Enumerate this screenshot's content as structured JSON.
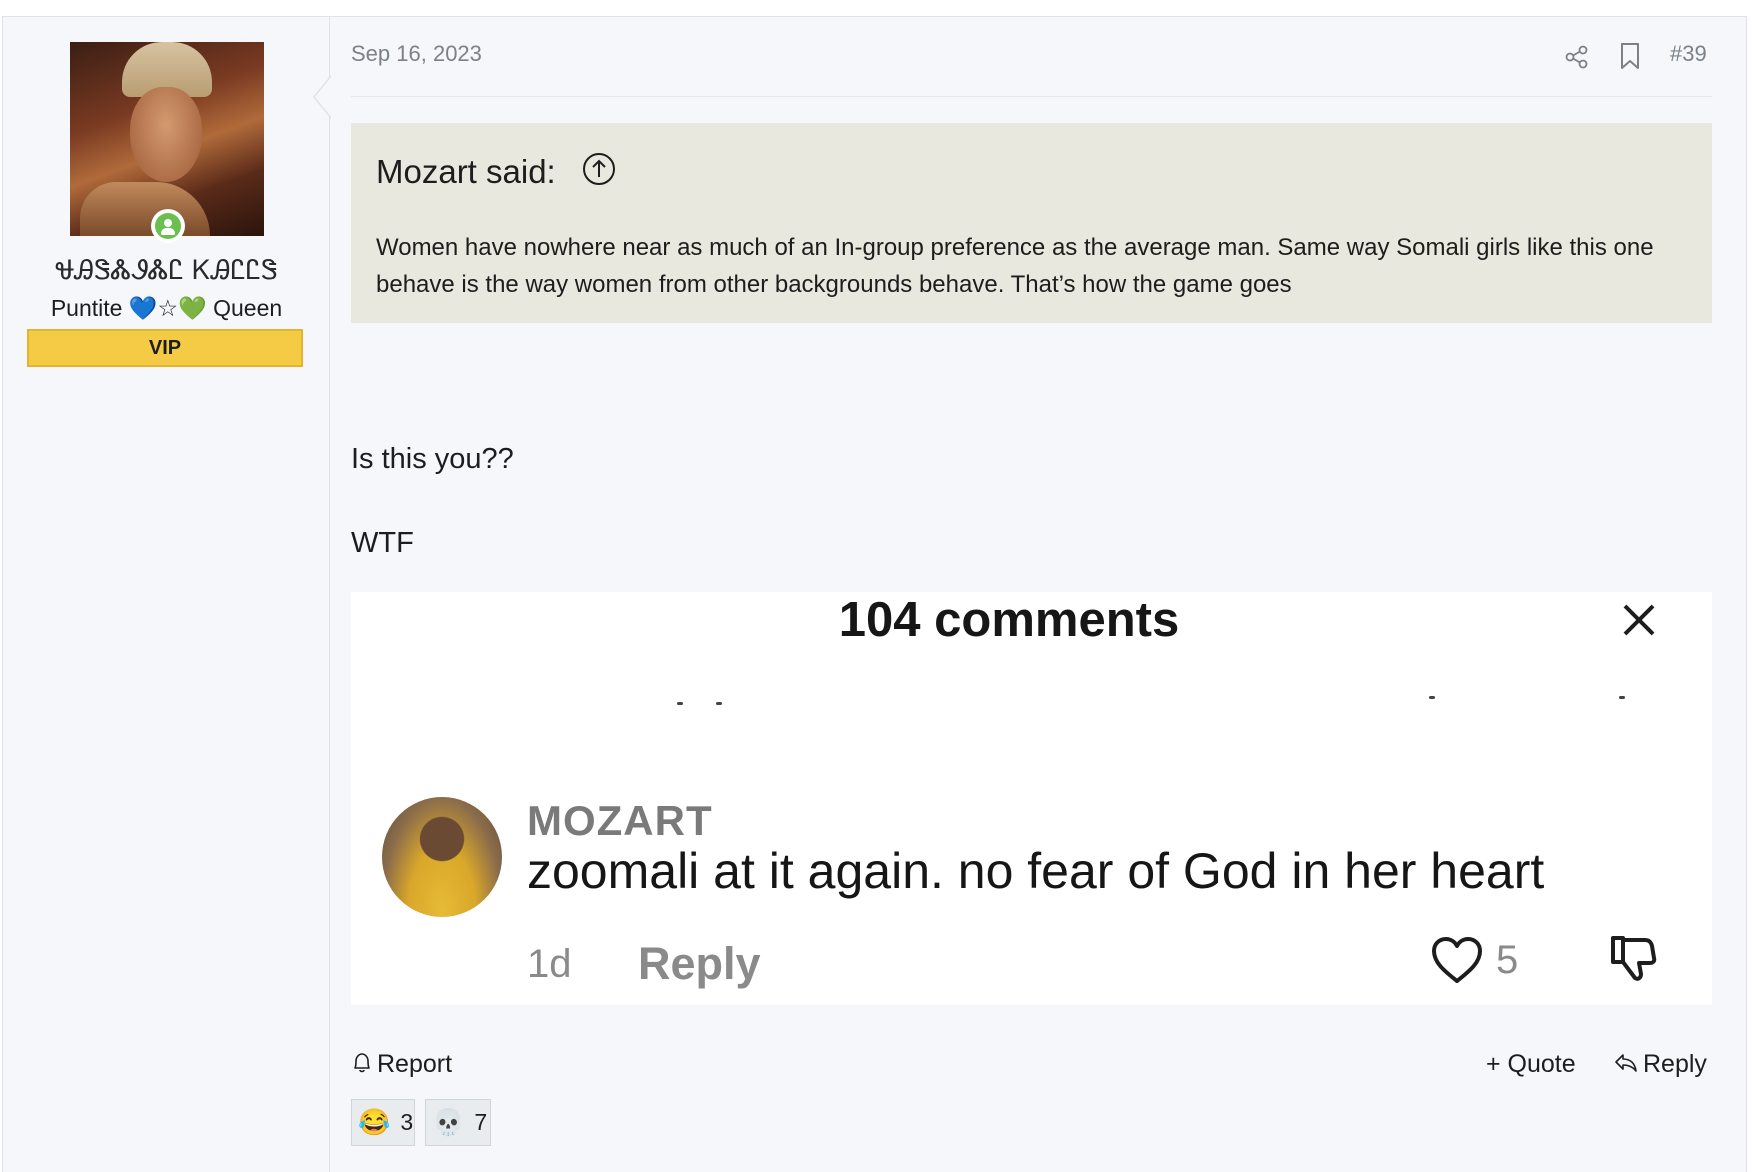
{
  "user": {
    "name": "ᏠᎯᏕᏜᏭᏜᏝ ᏦᎯᏝᏝᏕ",
    "title": "Puntite 💙☆💚 Queen",
    "banner": "VIP"
  },
  "post": {
    "date": "Sep 16, 2023",
    "number": "#39",
    "quote": {
      "title": "Mozart said:",
      "text": "Women have nowhere near as much of an In-group preference as the average man. Same way Somali girls like this one behave is the way women from other backgrounds behave. That’s how the game goes"
    },
    "body_line1": "Is this you??",
    "body_line2": "WTF",
    "embed": {
      "comments_count": "104 comments",
      "commenter_name": "MOZART",
      "comment_text": "zoomali at it again. no fear of God in her heart",
      "age": "1d",
      "reply_label": "Reply",
      "like_count": "5"
    },
    "actions": {
      "report": "Report",
      "quote": "+ Quote",
      "reply": "Reply"
    },
    "reactions": [
      {
        "emoji": "😂",
        "count": "3"
      },
      {
        "emoji": "💀",
        "count": "7"
      }
    ]
  }
}
